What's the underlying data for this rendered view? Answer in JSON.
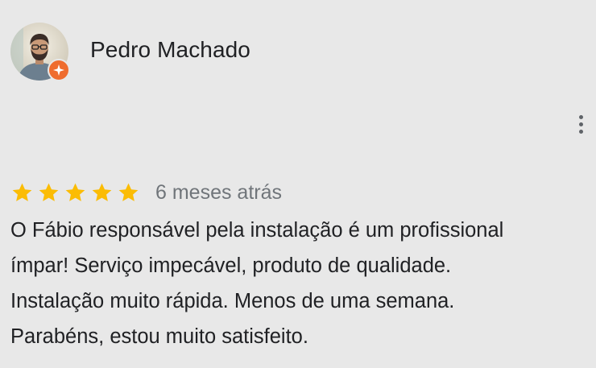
{
  "reviewer": {
    "name": "Pedro Machado",
    "avatar_icon": "profile-photo",
    "badge_icon": "local-guide-badge-icon",
    "badge_color": "#ef6c2e"
  },
  "menu": {
    "icon": "more-vert-icon"
  },
  "rating": {
    "value": 5,
    "max": 5,
    "star_color": "#fbbc04",
    "date": "6 meses atrás"
  },
  "review": {
    "lines": [
      "O Fábio responsável pela instalação é um profissional",
      "ímpar! Serviço impecável, produto de qualidade.",
      "Instalação muito rápida. Menos de uma semana.",
      "Parabéns, estou muito satisfeito."
    ]
  }
}
